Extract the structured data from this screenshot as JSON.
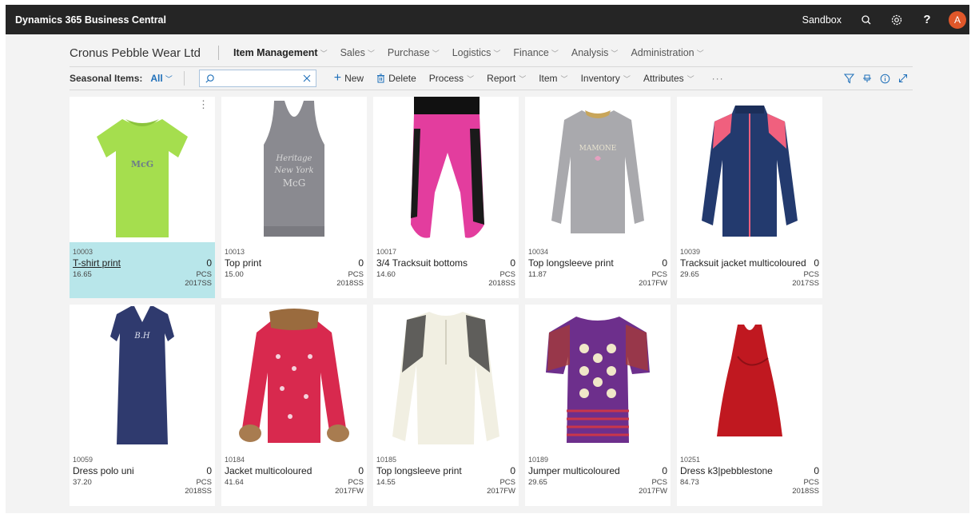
{
  "header": {
    "app_title": "Dynamics 365 Business Central",
    "environment": "Sandbox",
    "avatar_initial": "A",
    "help_label": "?"
  },
  "nav": {
    "company": "Cronus Pebble Wear Ltd",
    "items": [
      "Item Management",
      "Sales",
      "Purchase",
      "Logistics",
      "Finance",
      "Analysis",
      "Administration"
    ],
    "active": "Item Management"
  },
  "actionbar": {
    "view_label": "Seasonal Items:",
    "view_value": "All",
    "search_placeholder": "",
    "new_label": "New",
    "delete_label": "Delete",
    "menus": [
      "Process",
      "Report",
      "Item",
      "Inventory",
      "Attributes"
    ],
    "more": "···"
  },
  "items": [
    {
      "no": "10003",
      "description": "T-shirt print",
      "qty": "0",
      "price": "16.65",
      "uom": "PCS",
      "season": "2017SS",
      "selected": true
    },
    {
      "no": "10013",
      "description": "Top print",
      "qty": "0",
      "price": "15.00",
      "uom": "PCS",
      "season": "2018SS"
    },
    {
      "no": "10017",
      "description": "3/4 Tracksuit bottoms",
      "qty": "0",
      "price": "14.60",
      "uom": "PCS",
      "season": "2018SS"
    },
    {
      "no": "10034",
      "description": "Top longsleeve print",
      "qty": "0",
      "price": "11.87",
      "uom": "PCS",
      "season": "2017FW"
    },
    {
      "no": "10039",
      "description": "Tracksuit jacket multicoloured",
      "qty": "0",
      "price": "29.65",
      "uom": "PCS",
      "season": "2017SS"
    },
    {
      "no": "10059",
      "description": "Dress polo uni",
      "qty": "0",
      "price": "37.20",
      "uom": "PCS",
      "season": "2018SS"
    },
    {
      "no": "10184",
      "description": "Jacket multicoloured",
      "qty": "0",
      "price": "41.64",
      "uom": "PCS",
      "season": "2017FW"
    },
    {
      "no": "10185",
      "description": "Top longsleeve print",
      "qty": "0",
      "price": "14.55",
      "uom": "PCS",
      "season": "2017FW"
    },
    {
      "no": "10189",
      "description": "Jumper multicoloured",
      "qty": "0",
      "price": "29.65",
      "uom": "PCS",
      "season": "2017FW"
    },
    {
      "no": "10251",
      "description": "Dress k3|pebblestone",
      "qty": "0",
      "price": "84.73",
      "uom": "PCS",
      "season": "2018SS"
    }
  ],
  "colors": {
    "topbar": "#252525",
    "accent": "#1e6fb9",
    "selected_row": "#b8e6ea",
    "avatar": "#e0572a"
  }
}
